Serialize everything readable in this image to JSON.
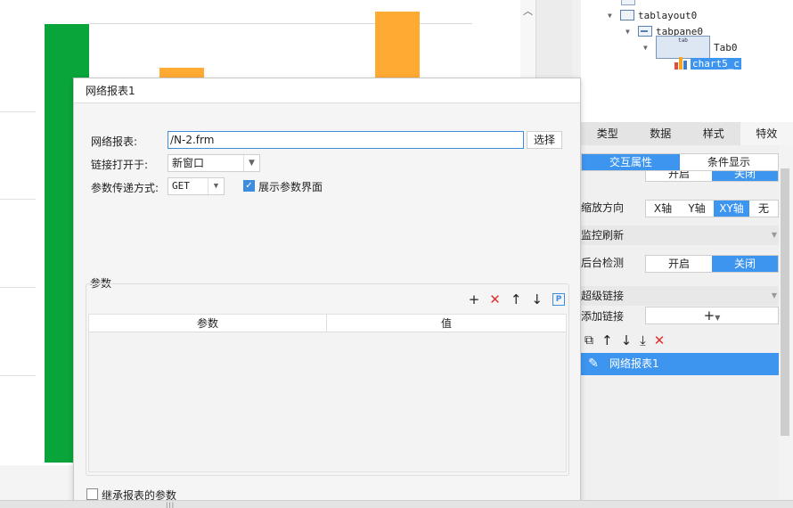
{
  "tree": {
    "nodes": [
      {
        "label": "tablayout0",
        "icon": "layout-icon"
      },
      {
        "label": "tabpane0",
        "icon": "tabpane-icon"
      },
      {
        "label": "Tab0",
        "icon": "tab-icon",
        "badge": "tab"
      },
      {
        "label": "chart5_c",
        "icon": "chart-icon",
        "selected": true
      }
    ]
  },
  "tabs": [
    {
      "label": "类型"
    },
    {
      "label": "数据"
    },
    {
      "label": "样式"
    },
    {
      "label": "特效",
      "active": true
    }
  ],
  "subtabs": [
    {
      "label": "交互属性",
      "active": true
    },
    {
      "label": "条件显示"
    }
  ],
  "props": {
    "partial_seg": {
      "left": "开启",
      "right": "关闭"
    },
    "zoom": {
      "label": "缩放方向",
      "options": [
        "X轴",
        "Y轴",
        "XY轴",
        "无"
      ],
      "selected": "XY轴"
    },
    "monitor_refresh": {
      "label": "监控刷新"
    },
    "backend_check": {
      "label": "后台检测",
      "on": "开启",
      "off": "关闭",
      "selected": "关闭"
    },
    "hyperlink": {
      "label": "超级链接"
    },
    "add_link": {
      "label": "添加链接",
      "button": "+"
    },
    "link_items": [
      {
        "label": "网络报表1"
      }
    ]
  },
  "dialog": {
    "title": "网络报表1",
    "report_label": "网络报表:",
    "report_path": "/N-2.frm",
    "pick_label": "选择",
    "open_in_label": "链接打开于:",
    "open_in_value": "新窗口",
    "method_label": "参数传递方式:",
    "method_value": "GET",
    "show_params_label": "展示参数界面",
    "show_params_checked": true,
    "params_section": "参数",
    "col_param": "参数",
    "col_value": "值",
    "inherit_label": "继承报表的参数",
    "inherit_checked": false
  },
  "colors": {
    "accent": "#3d95f0",
    "bar_green": "#0aa53a",
    "bar_orange": "#ffaa33",
    "delete_red": "#e03030"
  }
}
